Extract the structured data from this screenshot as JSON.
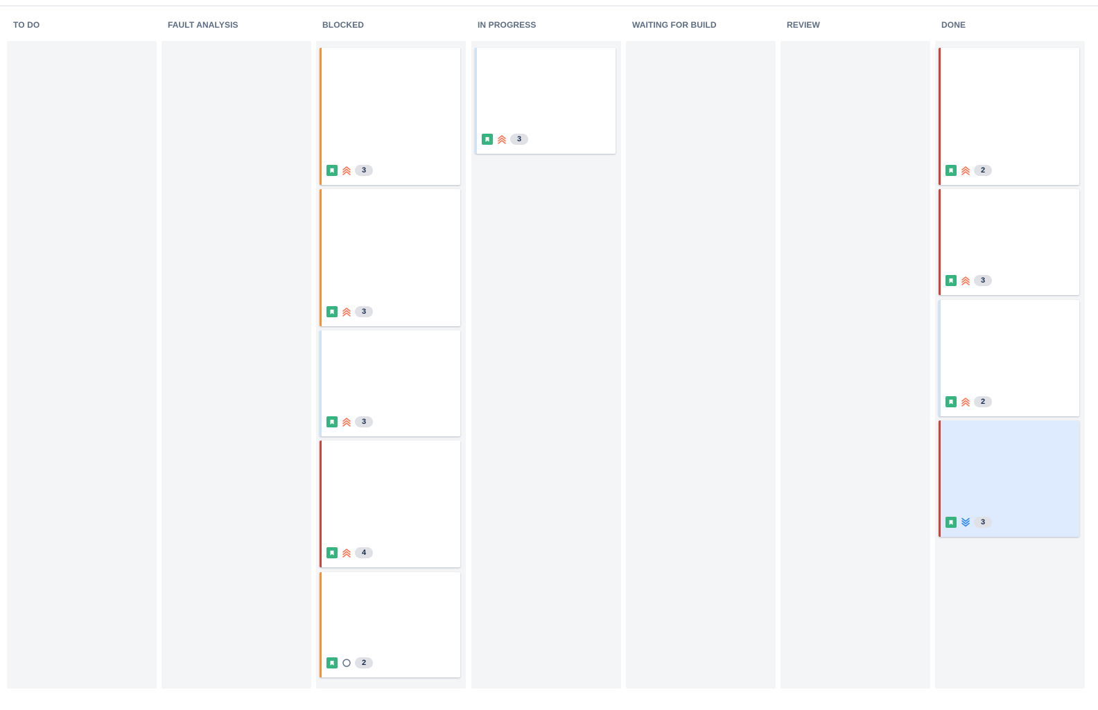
{
  "colors": {
    "header_text": "#5e6c84",
    "column_bg": "#f4f5f7",
    "story_green": "#36b37e",
    "priority_high": "#ff7452",
    "priority_low": "#2684ff",
    "epic_orange": "#f79232",
    "epic_red": "#d04437",
    "epic_lightblue": "#cfe3f7",
    "flagged_bg": "#deebff"
  },
  "columns": [
    {
      "title": "TO DO"
    },
    {
      "title": "FAULT ANALYSIS"
    },
    {
      "title": "BLOCKED"
    },
    {
      "title": "IN PROGRESS"
    },
    {
      "title": "WAITING FOR BUILD"
    },
    {
      "title": "REVIEW"
    },
    {
      "title": "DONE"
    }
  ],
  "cards": {
    "blocked": [
      {
        "type_icon": "story-icon",
        "priority_icon": "priority-highest-icon",
        "points": "3",
        "edge": "orange"
      },
      {
        "type_icon": "story-icon",
        "priority_icon": "priority-highest-icon",
        "points": "3",
        "edge": "orange"
      },
      {
        "type_icon": "story-icon",
        "priority_icon": "priority-highest-icon",
        "points": "3",
        "edge": "lightblue"
      },
      {
        "type_icon": "story-icon",
        "priority_icon": "priority-highest-icon",
        "points": "4",
        "edge": "red"
      },
      {
        "type_icon": "story-icon",
        "priority_icon": "priority-none-icon",
        "points": "2",
        "edge": "orange"
      }
    ],
    "in_progress": [
      {
        "type_icon": "story-icon",
        "priority_icon": "priority-highest-icon",
        "points": "3",
        "edge": "lightblue"
      }
    ],
    "done": [
      {
        "type_icon": "story-icon",
        "priority_icon": "priority-highest-icon",
        "points": "2",
        "edge": "red"
      },
      {
        "type_icon": "story-icon",
        "priority_icon": "priority-highest-icon",
        "points": "3",
        "edge": "red"
      },
      {
        "type_icon": "story-icon",
        "priority_icon": "priority-highest-icon",
        "points": "2",
        "edge": "lightblue"
      },
      {
        "type_icon": "story-icon",
        "priority_icon": "priority-lowest-icon",
        "points": "3",
        "edge": "red",
        "flagged": true
      }
    ]
  }
}
